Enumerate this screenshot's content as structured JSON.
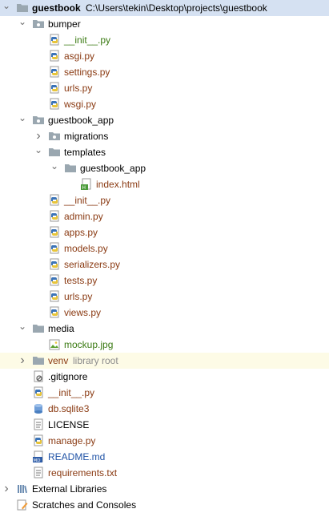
{
  "tree": {
    "rows": [
      {
        "label": "guestbook",
        "extra": "C:\\Users\\tekin\\Desktop\\projects\\guestbook",
        "extra_class": "path",
        "icon": "folder-icon",
        "arrow": "open",
        "depth": 0,
        "color": "bold",
        "selected": true
      },
      {
        "label": "bumper",
        "icon": "package-folder-icon",
        "arrow": "open",
        "depth": 1,
        "color": "default"
      },
      {
        "label": "__init__.py",
        "icon": "python-file-icon",
        "depth": 2,
        "color": "green"
      },
      {
        "label": "asgi.py",
        "icon": "python-file-icon",
        "depth": 2,
        "color": "brown"
      },
      {
        "label": "settings.py",
        "icon": "python-file-icon",
        "depth": 2,
        "color": "brown"
      },
      {
        "label": "urls.py",
        "icon": "python-file-icon",
        "depth": 2,
        "color": "brown"
      },
      {
        "label": "wsgi.py",
        "icon": "python-file-icon",
        "depth": 2,
        "color": "brown"
      },
      {
        "label": "guestbook_app",
        "icon": "package-folder-icon",
        "arrow": "open",
        "depth": 1,
        "color": "default"
      },
      {
        "label": "migrations",
        "icon": "package-folder-icon",
        "arrow": "closed",
        "depth": 2,
        "color": "default"
      },
      {
        "label": "templates",
        "icon": "folder-icon",
        "arrow": "open",
        "depth": 2,
        "color": "default"
      },
      {
        "label": "guestbook_app",
        "icon": "folder-icon",
        "arrow": "open",
        "depth": 3,
        "color": "default"
      },
      {
        "label": "index.html",
        "icon": "html-file-icon",
        "depth": 4,
        "color": "brown"
      },
      {
        "label": "__init__.py",
        "icon": "python-file-icon",
        "depth": 2,
        "color": "brown"
      },
      {
        "label": "admin.py",
        "icon": "python-file-icon",
        "depth": 2,
        "color": "brown"
      },
      {
        "label": "apps.py",
        "icon": "python-file-icon",
        "depth": 2,
        "color": "brown"
      },
      {
        "label": "models.py",
        "icon": "python-file-icon",
        "depth": 2,
        "color": "brown"
      },
      {
        "label": "serializers.py",
        "icon": "python-file-icon",
        "depth": 2,
        "color": "brown"
      },
      {
        "label": "tests.py",
        "icon": "python-file-icon",
        "depth": 2,
        "color": "brown"
      },
      {
        "label": "urls.py",
        "icon": "python-file-icon",
        "depth": 2,
        "color": "brown"
      },
      {
        "label": "views.py",
        "icon": "python-file-icon",
        "depth": 2,
        "color": "brown"
      },
      {
        "label": "media",
        "icon": "folder-icon",
        "arrow": "open",
        "depth": 1,
        "color": "default"
      },
      {
        "label": "mockup.jpg",
        "icon": "image-file-icon",
        "depth": 2,
        "color": "green"
      },
      {
        "label": "venv",
        "extra": "library root",
        "extra_class": "muted",
        "icon": "folder-icon",
        "arrow": "closed",
        "depth": 1,
        "color": "brown",
        "venv": true
      },
      {
        "label": ".gitignore",
        "icon": "ignore-file-icon",
        "depth": 1,
        "color": "default"
      },
      {
        "label": "__init__.py",
        "icon": "python-file-icon",
        "depth": 1,
        "color": "brown"
      },
      {
        "label": "db.sqlite3",
        "icon": "database-file-icon",
        "depth": 1,
        "color": "brown"
      },
      {
        "label": "LICENSE",
        "icon": "text-file-icon",
        "depth": 1,
        "color": "default"
      },
      {
        "label": "manage.py",
        "icon": "python-file-icon",
        "depth": 1,
        "color": "brown"
      },
      {
        "label": "README.md",
        "icon": "markdown-file-icon",
        "depth": 1,
        "color": "blue"
      },
      {
        "label": "requirements.txt",
        "icon": "text-file-icon",
        "depth": 1,
        "color": "brown"
      },
      {
        "label": "External Libraries",
        "icon": "libraries-icon",
        "arrow": "closed",
        "depth": 0,
        "color": "default"
      },
      {
        "label": "Scratches and Consoles",
        "icon": "scratches-icon",
        "depth": 0,
        "color": "default"
      }
    ]
  }
}
